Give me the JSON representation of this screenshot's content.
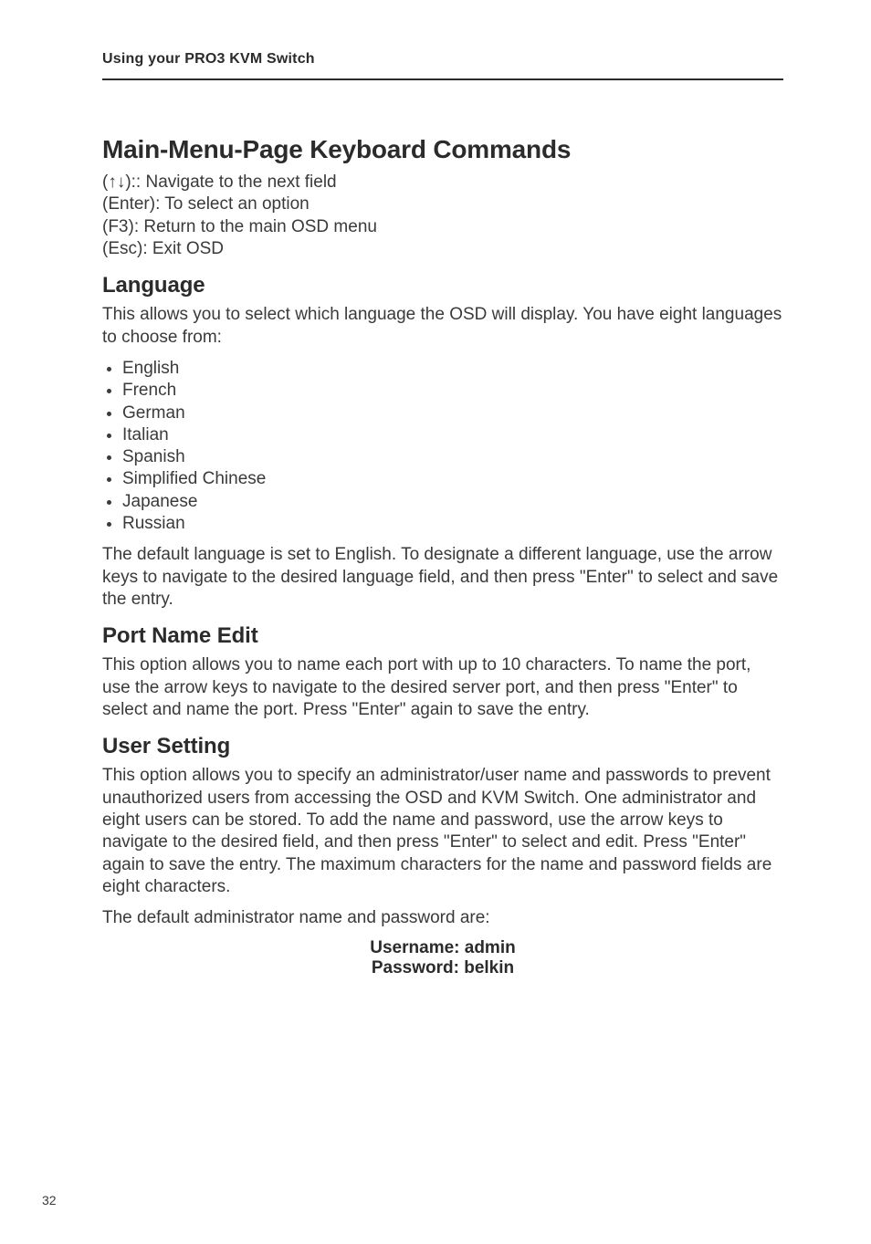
{
  "running_head": "Using your PRO3 KVM Switch",
  "section_heading": "Main-Menu-Page Keyboard Commands",
  "commands": {
    "nav": "(↑↓):: Navigate to the next field",
    "enter": "(Enter): To select an option",
    "f3": "(F3): Return to the main OSD menu",
    "esc": "(Esc): Exit OSD"
  },
  "language": {
    "heading": "Language",
    "intro": "This allows you to select which language the OSD will display. You have eight languages to choose from:",
    "items": [
      "English",
      "French",
      "German",
      "Italian",
      "Spanish",
      "Simplified Chinese",
      "Japanese",
      "Russian"
    ],
    "outro": "The default language is set to English. To designate a different language, use the arrow keys to navigate to the desired language field, and then press \"Enter\" to select and save the entry."
  },
  "port_name_edit": {
    "heading": "Port Name Edit",
    "body": "This option allows you to name each port with up to 10 characters. To name the port, use the arrow keys to navigate to the desired server port, and then press \"Enter\" to select and name the port. Press \"Enter\" again to save the entry."
  },
  "user_setting": {
    "heading": "User Setting",
    "body": "This option allows you to specify an administrator/user name and passwords to prevent unauthorized users from accessing the OSD and KVM Switch. One administrator and eight users can be stored. To add the name and password, use the arrow keys to navigate to the desired field, and then press \"Enter\" to select and edit. Press \"Enter\" again to save the entry. The maximum characters for the name and password fields are eight characters.",
    "defaults_intro": "The default administrator name and password are:",
    "username_line": "Username: admin",
    "password_line": "Password: belkin"
  },
  "page_number": "32"
}
